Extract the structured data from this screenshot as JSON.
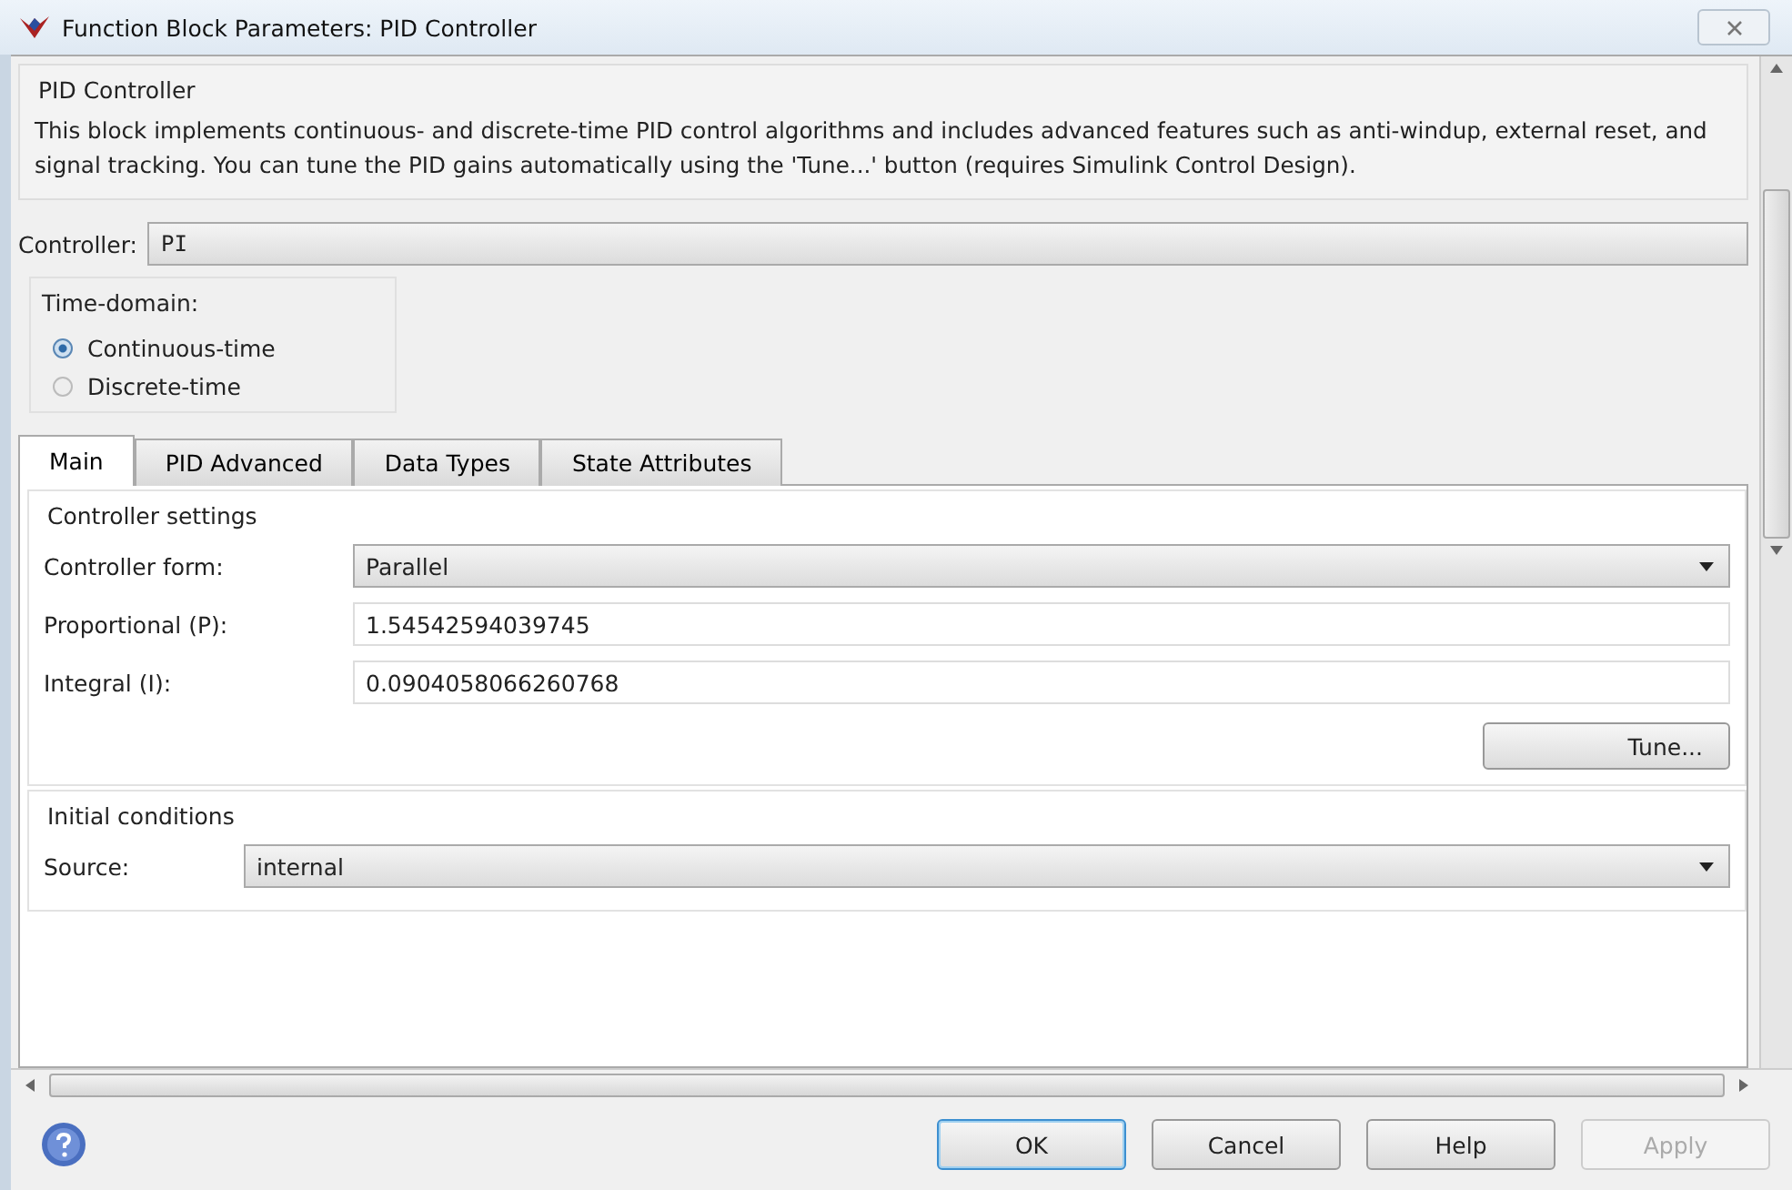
{
  "window": {
    "title": "Function Block Parameters: PID Controller"
  },
  "block": {
    "title": "PID Controller",
    "description": "This block implements continuous- and discrete-time PID control algorithms and includes advanced features such as anti-windup, external reset, and signal tracking. You can tune the PID gains automatically using the 'Tune...' button (requires Simulink Control Design)."
  },
  "controller": {
    "label": "Controller:",
    "value": "PI"
  },
  "time_domain": {
    "title": "Time-domain:",
    "options": [
      {
        "label": "Continuous-time",
        "selected": true
      },
      {
        "label": "Discrete-time",
        "selected": false
      }
    ]
  },
  "tabs": [
    {
      "label": "Main",
      "selected": true
    },
    {
      "label": "PID Advanced",
      "selected": false
    },
    {
      "label": "Data Types",
      "selected": false
    },
    {
      "label": "State Attributes",
      "selected": false
    }
  ],
  "controller_settings": {
    "title": "Controller settings",
    "fields": [
      {
        "kind": "dropdown",
        "label": "Controller form:",
        "value": "Parallel"
      },
      {
        "kind": "text",
        "label": "Proportional (P):",
        "value": "1.54542594039745"
      },
      {
        "kind": "text",
        "label": "Integral (I):",
        "value": "0.0904058066260768"
      }
    ],
    "tune_button": "Tune..."
  },
  "initial_conditions": {
    "title": "Initial conditions",
    "fields": [
      {
        "kind": "dropdown",
        "label": "Source:",
        "value": "internal"
      }
    ]
  },
  "buttons": [
    {
      "label": "OK",
      "default": true,
      "disabled": false
    },
    {
      "label": "Cancel",
      "default": false,
      "disabled": false
    },
    {
      "label": "Help",
      "default": false,
      "disabled": false
    },
    {
      "label": "Apply",
      "default": false,
      "disabled": true
    }
  ]
}
